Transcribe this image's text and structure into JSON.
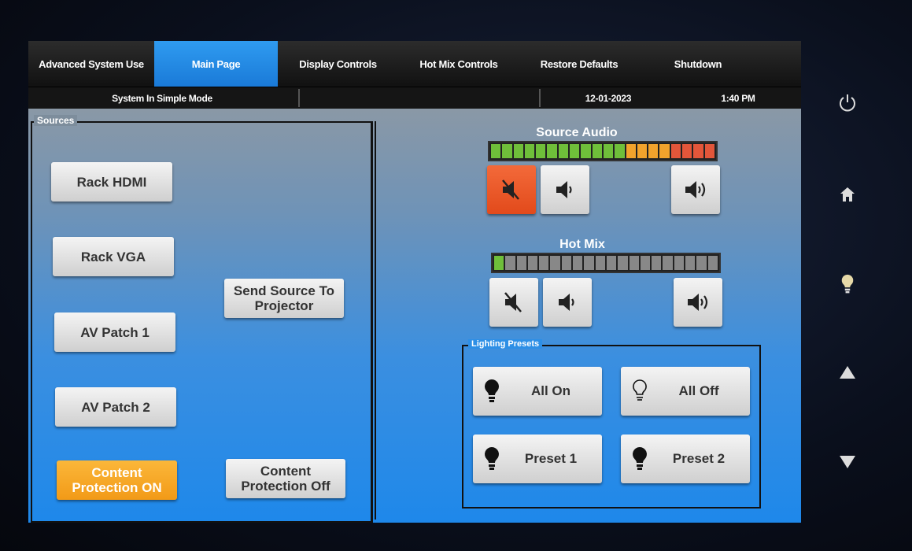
{
  "tabs": [
    {
      "label": "Advanced System Use",
      "active": false
    },
    {
      "label": "Main Page",
      "active": true
    },
    {
      "label": "Display Controls",
      "active": false
    },
    {
      "label": "Hot Mix Controls",
      "active": false
    },
    {
      "label": "Restore Defaults",
      "active": false
    },
    {
      "label": "Shutdown",
      "active": false
    }
  ],
  "status": {
    "mode": "System In Simple Mode",
    "date": "12-01-2023",
    "time": "1:40 PM"
  },
  "sources": {
    "title": "Sources",
    "buttons": [
      "Rack HDMI",
      "Rack VGA",
      "AV Patch 1",
      "AV Patch 2"
    ],
    "send_source": "Send Source To Projector",
    "content_protection_on": "Content Protection ON",
    "content_protection_off": "Content Protection Off"
  },
  "source_audio": {
    "title": "Source Audio",
    "segments": 20,
    "lit": 20,
    "muted": true
  },
  "hot_mix": {
    "title": "Hot Mix",
    "segments": 20,
    "lit": 1,
    "muted": false
  },
  "lighting": {
    "title": "Lighting Presets",
    "all_on": "All On",
    "all_off": "All Off",
    "preset1": "Preset 1",
    "preset2": "Preset 2"
  },
  "colors": {
    "active_tab": "#1f86e2",
    "mute_active": "#e8511f",
    "content_on": "#f5a623"
  },
  "side_icons": [
    "power-icon",
    "home-icon",
    "lightbulb-icon",
    "arrow-up-icon",
    "arrow-down-icon"
  ]
}
